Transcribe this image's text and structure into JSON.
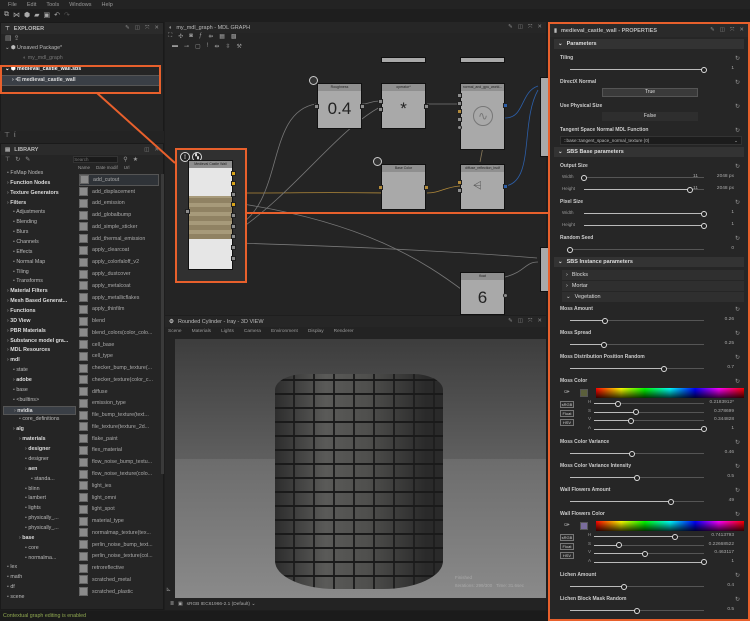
{
  "menu": [
    "File",
    "Edit",
    "Tools",
    "Windows",
    "Help"
  ],
  "explorer": {
    "title": "EXPLORER",
    "items": [
      {
        "label": "Unsaved Package*"
      },
      {
        "label": "my_mdl_graph"
      },
      {
        "label": "medieval_castle_wall.sbs"
      },
      {
        "label": "medieval_castle_wall"
      }
    ]
  },
  "library": {
    "title": "LIBRARY",
    "search_placeholder": "Search",
    "columns": [
      "Name",
      "Date modif",
      "Url"
    ],
    "tree": [
      {
        "label": "FxMap Nodes",
        "d": 0
      },
      {
        "label": "Function Nodes",
        "d": 0,
        "b": 1
      },
      {
        "label": "Texture Generators",
        "d": 0,
        "b": 1
      },
      {
        "label": "Filters",
        "d": 0,
        "b": 1
      },
      {
        "label": "Adjustments",
        "d": 1
      },
      {
        "label": "Blending",
        "d": 1
      },
      {
        "label": "Blurs",
        "d": 1
      },
      {
        "label": "Channels",
        "d": 1
      },
      {
        "label": "Effects",
        "d": 1
      },
      {
        "label": "Normal Map",
        "d": 1
      },
      {
        "label": "Tiling",
        "d": 1
      },
      {
        "label": "Transforms",
        "d": 1
      },
      {
        "label": "Material Filters",
        "d": 0,
        "b": 1
      },
      {
        "label": "Mesh Based Generat...",
        "d": 0,
        "b": 1
      },
      {
        "label": "Functions",
        "d": 0,
        "b": 1
      },
      {
        "label": "3D View",
        "d": 0,
        "b": 1
      },
      {
        "label": "PBR Materials",
        "d": 0,
        "b": 1
      },
      {
        "label": "Substance model gra...",
        "d": 0,
        "b": 1
      },
      {
        "label": "MDL Resources",
        "d": 0,
        "b": 1
      },
      {
        "label": "mdl",
        "d": 0,
        "b": 1
      },
      {
        "label": "state",
        "d": 1
      },
      {
        "label": "adobe",
        "d": 1,
        "b": 1
      },
      {
        "label": "base",
        "d": 1
      },
      {
        "label": "<builtins>",
        "d": 1
      },
      {
        "label": "nvidia",
        "d": 1,
        "b": 1,
        "sel": 1
      },
      {
        "label": "core_definitions",
        "d": 2
      },
      {
        "label": "alg",
        "d": 1,
        "b": 1
      },
      {
        "label": "materials",
        "d": 2,
        "b": 1
      },
      {
        "label": "designer",
        "d": 3,
        "b": 1
      },
      {
        "label": "designer",
        "d": 3
      },
      {
        "label": "aen",
        "d": 3,
        "b": 1
      },
      {
        "label": "standa...",
        "d": 4
      },
      {
        "label": "blinn",
        "d": 3
      },
      {
        "label": "lambert",
        "d": 3
      },
      {
        "label": "lights",
        "d": 3
      },
      {
        "label": "physically_...",
        "d": 3
      },
      {
        "label": "physically_...",
        "d": 3
      },
      {
        "label": "base",
        "d": 2,
        "b": 1
      },
      {
        "label": "core",
        "d": 3
      },
      {
        "label": "normalma...",
        "d": 3
      },
      {
        "label": "lex",
        "d": 0
      },
      {
        "label": "math",
        "d": 0
      },
      {
        "label": "df",
        "d": 0
      },
      {
        "label": "scene",
        "d": 0
      }
    ],
    "items": [
      "add_cutout",
      "add_displacement",
      "add_emission",
      "add_globalbump",
      "add_simple_sticker",
      "add_thermal_emission",
      "apply_clearcoat",
      "apply_colorfaloff_v2",
      "apply_dustcover",
      "apply_metalcoat",
      "apply_metallicflakes",
      "apply_thinfilm",
      "blend",
      "blend_colors(color_colo...",
      "cell_base",
      "cell_type",
      "checker_bump_texture(...",
      "checker_texture(color_c...",
      "diffuse",
      "emission_type",
      "file_bump_texture(text...",
      "file_texture(texture_2d...",
      "flake_paint",
      "flex_material",
      "flow_noise_bump_textu...",
      "flow_noise_texture(colo...",
      "light_ies",
      "light_omni",
      "light_spot",
      "material_type",
      "normalmap_texture(tex...",
      "perlin_noise_bump_text...",
      "perlin_noise_texture(col...",
      "retroreflective",
      "scratched_metal",
      "scratched_plastic"
    ]
  },
  "graph": {
    "title": "my_mdl_graph - MDL GRAPH",
    "nodes": {
      "roughness": {
        "title": "Roughness",
        "value": "0.4"
      },
      "multiply": {
        "title": "operator*",
        "value": "*"
      },
      "normal": {
        "title": "normal_and_gpu_world..."
      },
      "basecolor": {
        "title": "Base Color"
      },
      "diffuse": {
        "title": "diffuse_reflection_bsdf"
      },
      "sbs": {
        "title": "Medieval Castle Wall"
      },
      "float": {
        "title": "float",
        "value": "6"
      }
    }
  },
  "view3d": {
    "title": "Rounded Cylinder - Iray - 3D VIEW",
    "menu": [
      "Scene",
      "Materials",
      "Lights",
      "Camera",
      "Environment",
      "Display",
      "Renderer"
    ],
    "overlay_status": "Finished",
    "overlay_info": "Iterations: 299/300   Time: 31.6sec",
    "colorspace": "sRGB IEC61966-2.1 (Default)"
  },
  "status": "Contextual graph editing is enabled",
  "properties": {
    "title": "medieval_castle_wall - PROPERTIES",
    "rows": [
      {
        "t": "group",
        "label": "Parameters"
      },
      {
        "t": "slider",
        "label": "Tiling",
        "pos": 1.0,
        "value": "1"
      },
      {
        "t": "button",
        "label": "DirectX Normal",
        "value": "True"
      },
      {
        "t": "button",
        "label": "Use Physical Size",
        "value": "False",
        "flat": 1
      },
      {
        "t": "dropdown",
        "label": "Tangent Space Normal MDL Function",
        "value": "::base::tangent_space_normal_texture (0)"
      },
      {
        "t": "group",
        "label": "SBS Base parameters"
      },
      {
        "t": "size",
        "label": "Output Size",
        "rows": [
          {
            "sub": "Width",
            "pos": 0.0,
            "value": "11",
            "extra": "2048 px"
          },
          {
            "sub": "Height",
            "pos": 0.88,
            "value": "11",
            "extra": "2048 px"
          }
        ]
      },
      {
        "t": "size",
        "label": "Pixel Size",
        "rows": [
          {
            "sub": "Width",
            "pos": 1.0,
            "value": "1"
          },
          {
            "sub": "Height",
            "pos": 1.0,
            "value": "1"
          }
        ]
      },
      {
        "t": "slider",
        "label": "Random Seed",
        "pos": 0.0,
        "value": "0"
      },
      {
        "t": "group",
        "label": "SBS Instance parameters"
      },
      {
        "t": "sub",
        "label": "Blocks",
        "open": 0
      },
      {
        "t": "sub",
        "label": "Mortar",
        "open": 0
      },
      {
        "t": "sub",
        "label": "Vegetation",
        "open": 1
      },
      {
        "t": "slider",
        "label": "Moss Amount",
        "pos": 0.26,
        "value": "0.26"
      },
      {
        "t": "slider",
        "label": "Moss Spread",
        "pos": 0.25,
        "value": "0.25"
      },
      {
        "t": "slider",
        "label": "Moss Distribution Position Random",
        "pos": 0.7,
        "value": "0.7"
      },
      {
        "t": "color",
        "label": "Moss Color",
        "swatch": "#5b5f3b",
        "modes": [
          "sRGB",
          "Float",
          "HSV"
        ],
        "ch": [
          {
            "k": "H",
            "pos": 0.22,
            "value": "0.2183912*"
          },
          {
            "k": "S",
            "pos": 0.38,
            "value": "0.378699"
          },
          {
            "k": "V",
            "pos": 0.34,
            "value": "0.344828"
          },
          {
            "k": "A",
            "pos": 1.0,
            "value": "1"
          }
        ]
      },
      {
        "t": "slider",
        "label": "Moss Color Variance",
        "pos": 0.46,
        "value": "0.46"
      },
      {
        "t": "slider",
        "label": "Moss Color Variance Intensity",
        "pos": 0.5,
        "value": "0.5"
      },
      {
        "t": "slider",
        "label": "Wall Flowers Amount",
        "pos": 0.75,
        "value": "49"
      },
      {
        "t": "color",
        "label": "Wall Flowers Color",
        "swatch": "#7a6d9c",
        "modes": [
          "sRGB",
          "Float",
          "HSV"
        ],
        "ch": [
          {
            "k": "H",
            "pos": 0.74,
            "value": "0.7413793"
          },
          {
            "k": "S",
            "pos": 0.23,
            "value": "0.22668522"
          },
          {
            "k": "V",
            "pos": 0.46,
            "value": "0.463117"
          },
          {
            "k": "A",
            "pos": 1.0,
            "value": "1"
          }
        ]
      },
      {
        "t": "slider",
        "label": "Lichen Amount",
        "pos": 0.4,
        "value": "0.4"
      },
      {
        "t": "slider",
        "label": "Lichen Block Mask Random",
        "pos": 0.5,
        "value": "0.5"
      }
    ]
  },
  "colors": {
    "accent": "#e8602c"
  }
}
